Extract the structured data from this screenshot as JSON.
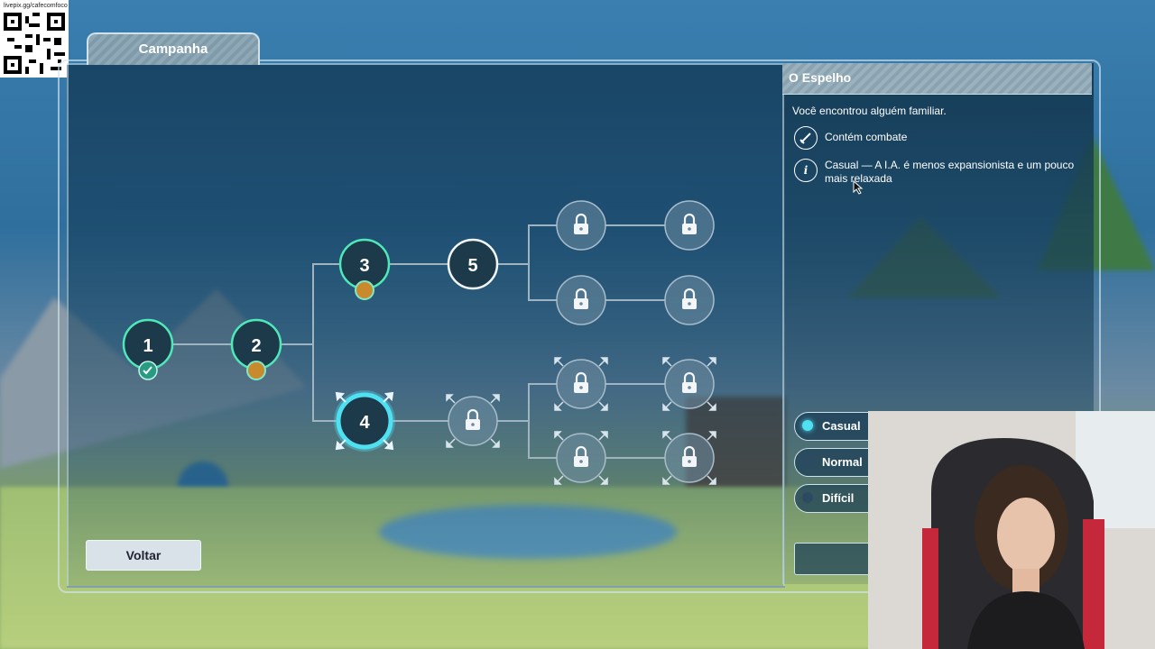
{
  "overlay": {
    "qr_url": "livepix.gg/cafecomfoco"
  },
  "campaign": {
    "tab_label": "Campanha",
    "back_button": "Voltar",
    "nodes": [
      {
        "id": "1",
        "label": "1",
        "state": "completed"
      },
      {
        "id": "2",
        "label": "2",
        "state": "available"
      },
      {
        "id": "3",
        "label": "3",
        "state": "available"
      },
      {
        "id": "4",
        "label": "4",
        "state": "selected"
      },
      {
        "id": "5",
        "label": "5",
        "state": "available"
      }
    ],
    "locked_nodes": 9
  },
  "mission": {
    "title": "O Espelho",
    "description": "Você encontrou alguém familiar.",
    "features": [
      {
        "icon": "sword-icon",
        "text": "Contém combate"
      },
      {
        "icon": "info-icon",
        "text": "Casual — A I.A. é menos expansionista e um pouco mais relaxada"
      }
    ],
    "difficulties": [
      {
        "label": "Casual",
        "selected": true
      },
      {
        "label": "Normal",
        "selected": false
      },
      {
        "label": "Difícil",
        "selected": false
      }
    ]
  },
  "colors": {
    "accent": "#4fe0f2",
    "completed": "#39d6a8",
    "medal": "#c98a2e"
  }
}
